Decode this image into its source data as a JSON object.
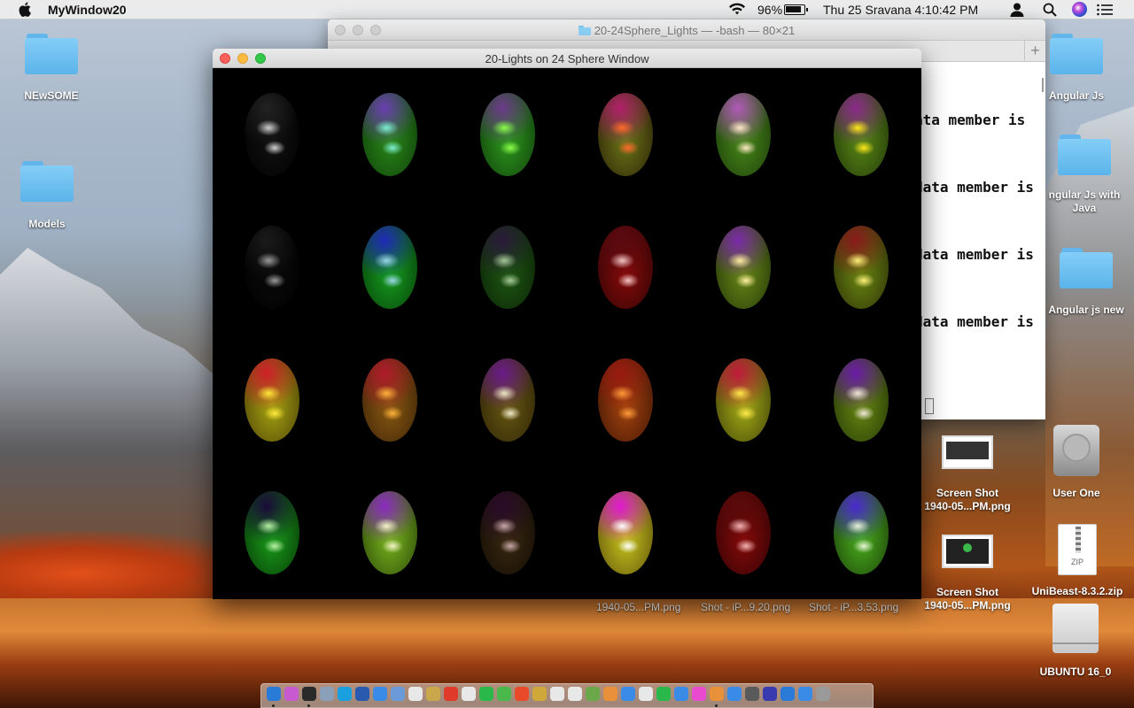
{
  "menubar": {
    "app_name": "MyWindow20",
    "battery_percent": "96%",
    "clock": "Thu 25 Sravana  4:10:42 PM"
  },
  "desktop_icons": {
    "newsome": "NEwSOME",
    "models": "Models",
    "angular_js": "Angular Js",
    "angular_js_with_java": "ngular Js with Java",
    "angular_js_new": "Angular js new",
    "screenshot_1": "Screen Shot 1940-05...PM.png",
    "user_one": "User One",
    "screenshot_2": "Screen Shot 1940-05...PM.png",
    "unibeast": "UniBeast-8.3.2.zip",
    "ubuntu": "UBUNTU 16_0",
    "zip_badge": "ZIP"
  },
  "bottom_labels": [
    "1940-05...PM.png",
    "Shot - iP...9.20.png",
    "Shot - iP...3.53.png"
  ],
  "terminal": {
    "title": "20-24Sphere_Lights — -bash — 80×21",
    "lines": [
      "ata member is",
      "data member is",
      "data member is",
      "data member is"
    ]
  },
  "gl_window": {
    "title": "20-Lights on 24 Sphere Window"
  },
  "spheres": [
    {
      "base": "#111111",
      "rim": "#000000",
      "top": "#222222",
      "hi": "#cfcfcf"
    },
    {
      "base": "#2a8a1a",
      "rim": "#0d3a08",
      "top": "#6a3fb0",
      "hi": "#7ef0d0"
    },
    {
      "base": "#2f9a1e",
      "rim": "#0e3a0a",
      "top": "#6b3a8a",
      "hi": "#8aff4a"
    },
    {
      "base": "#6b7a18",
      "rim": "#2a1a06",
      "top": "#b0206a",
      "hi": "#ff6a2a"
    },
    {
      "base": "#4a8a1a",
      "rim": "#183808",
      "top": "#b05ab8",
      "hi": "#ffe9c8"
    },
    {
      "base": "#5a8a16",
      "rim": "#1e3208",
      "top": "#8a2a8a",
      "hi": "#ffe81a"
    },
    {
      "base": "#0a0a0a",
      "rim": "#000000",
      "top": "#1a1a1a",
      "hi": "#9a9a9a"
    },
    {
      "base": "#16a01e",
      "rim": "#063a0a",
      "top": "#1e2ab8",
      "hi": "#9ad8e8"
    },
    {
      "base": "#1e5a12",
      "rim": "#0a1e06",
      "top": "#2a1a3a",
      "hi": "#a8c89a"
    },
    {
      "base": "#8a0a0a",
      "rim": "#2a0404",
      "top": "#5a0a10",
      "hi": "#f4c4c4"
    },
    {
      "base": "#6a8a16",
      "rim": "#203208",
      "top": "#7a2aa8",
      "hi": "#fff0a0"
    },
    {
      "base": "#6a8a12",
      "rim": "#2a2a06",
      "top": "#8a1a1a",
      "hi": "#fff07a"
    },
    {
      "base": "#a8a812",
      "rim": "#4a3a06",
      "top": "#d0202a",
      "hi": "#ffe83a"
    },
    {
      "base": "#8a5a12",
      "rim": "#3a2006",
      "top": "#b01a2a",
      "hi": "#ffb23a"
    },
    {
      "base": "#6a5a12",
      "rim": "#2a2006",
      "top": "#6a1a8a",
      "hi": "#f0e8c8"
    },
    {
      "base": "#a8460e",
      "rim": "#3a1204",
      "top": "#9a1a10",
      "hi": "#ff9a3a"
    },
    {
      "base": "#a8b018",
      "rim": "#3a3a06",
      "top": "#c01a3a",
      "hi": "#ffe84a"
    },
    {
      "base": "#6a8a12",
      "rim": "#203206",
      "top": "#6a1aa8",
      "hi": "#f0e8d8"
    },
    {
      "base": "#1aa01a",
      "rim": "#063206",
      "top": "#1a0a3a",
      "hi": "#b8f0a8"
    },
    {
      "base": "#7ab81e",
      "rim": "#284008",
      "top": "#8a2ac0",
      "hi": "#f4f4c8"
    },
    {
      "base": "#3a2a10",
      "rim": "#100a04",
      "top": "#2a0a2a",
      "hi": "#c8a8a8"
    },
    {
      "base": "#c8c81e",
      "rim": "#5a4a0a",
      "top": "#e01ad0",
      "hi": "#ffffff"
    },
    {
      "base": "#8a0a0a",
      "rim": "#2a0204",
      "top": "#5a0a0a",
      "hi": "#f4b4b4"
    },
    {
      "base": "#4ab01e",
      "rim": "#1a3a08",
      "top": "#4a2ad0",
      "hi": "#e8f4d8"
    }
  ],
  "dock_colors": [
    "#2a7bd8",
    "#c85ad0",
    "#2a2a2a",
    "#8aa0b8",
    "#1aa0e0",
    "#2a5ab0",
    "#3a8ae8",
    "#6a9ad8",
    "#e8e8e8",
    "#c8a84a",
    "#e03a2a",
    "#e8e8e8",
    "#2ab84a",
    "#4ab84a",
    "#e84a2a",
    "#d0a83a",
    "#e8e8e8",
    "#e8e8e8",
    "#6aa84a",
    "#e8903a",
    "#3a8ae8",
    "#e8e8e8",
    "#2ab84a",
    "#3a8ae8",
    "#e84ad0",
    "#e8903a",
    "#3a8ae8",
    "#5a5a5a",
    "#3a3ab0",
    "#2a7bd8",
    "#3a8ae8",
    "#9a9a9a"
  ]
}
